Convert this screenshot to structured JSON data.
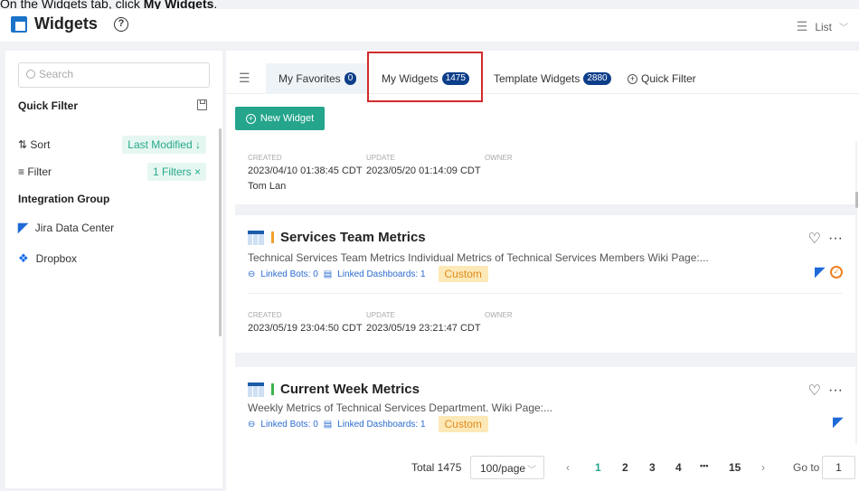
{
  "instruction": {
    "prefix": "On the Widgets tab, click ",
    "target": "My Widgets",
    "suffix": "."
  },
  "header": {
    "title": "Widgets",
    "view_label": "List"
  },
  "sidebar": {
    "search_placeholder": "Search",
    "quick_filter_title": "Quick Filter",
    "sort_label": "Sort",
    "sort_value": "Last Modified ↓",
    "filter_label": "Filter",
    "filter_value": "1 Filters ×",
    "integration_group_title": "Integration Group",
    "integrations": [
      "Jira Data Center",
      "Dropbox"
    ]
  },
  "tabs": [
    {
      "label": "My Favorites",
      "count": "0"
    },
    {
      "label": "My Widgets",
      "count": "1475"
    },
    {
      "label": "Template Widgets",
      "count": "2880"
    },
    {
      "label": "Quick Filter"
    }
  ],
  "new_widget_label": "New Widget",
  "meta_labels": {
    "created": "CREATED",
    "update": "UPDATE",
    "owner": "OWNER"
  },
  "widgets": [
    {
      "created": "2023/04/10 01:38:45 CDT",
      "updated": "2023/05/20 01:14:09 CDT",
      "owner": "Tom Lan"
    },
    {
      "title": "Services Team Metrics",
      "bar_color": "#f0a030",
      "description": "Technical Services Team Metrics Individual Metrics of Technical Services Members Wiki Page:...",
      "linked_bots": "Linked Bots: 0",
      "linked_dashboards": "Linked Dashboards: 1",
      "tag": "Custom",
      "created": "2023/05/19 23:04:50 CDT",
      "updated": "2023/05/19 23:21:47 CDT",
      "owner": ""
    },
    {
      "title": "Current Week Metrics",
      "bar_color": "#3cb44b",
      "description": "Weekly Metrics of Technical Services Department. Wiki Page:...",
      "linked_bots": "Linked Bots: 0",
      "linked_dashboards": "Linked Dashboards: 1",
      "tag": "Custom"
    }
  ],
  "pagination": {
    "total": "Total 1475",
    "page_size": "100/page",
    "pages": [
      "1",
      "2",
      "3",
      "4",
      "•••",
      "15"
    ],
    "current": "1",
    "goto_label": "Go to",
    "goto_value": "1"
  }
}
